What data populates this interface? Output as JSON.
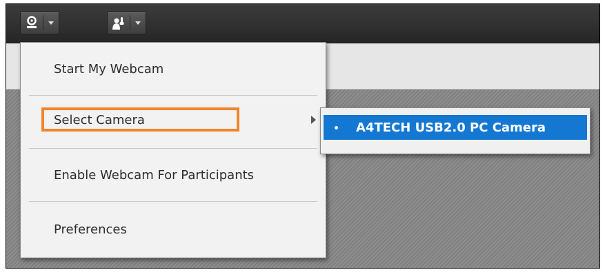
{
  "toolbar": {
    "buttons": [
      {
        "icon": "webcam-icon"
      },
      {
        "icon": "raise-hand-icon"
      }
    ]
  },
  "menu": {
    "items": [
      {
        "label": "Start My Webcam"
      },
      {
        "label": "Select Camera",
        "has_submenu": true,
        "highlighted": true
      },
      {
        "label": "Enable Webcam For Participants"
      },
      {
        "label": "Preferences"
      }
    ]
  },
  "submenu": {
    "items": [
      {
        "label": "A4TECH USB2.0 PC Camera",
        "selected": true
      }
    ]
  },
  "colors": {
    "highlight_box": "#f0852c",
    "selection": "#1478d2"
  }
}
